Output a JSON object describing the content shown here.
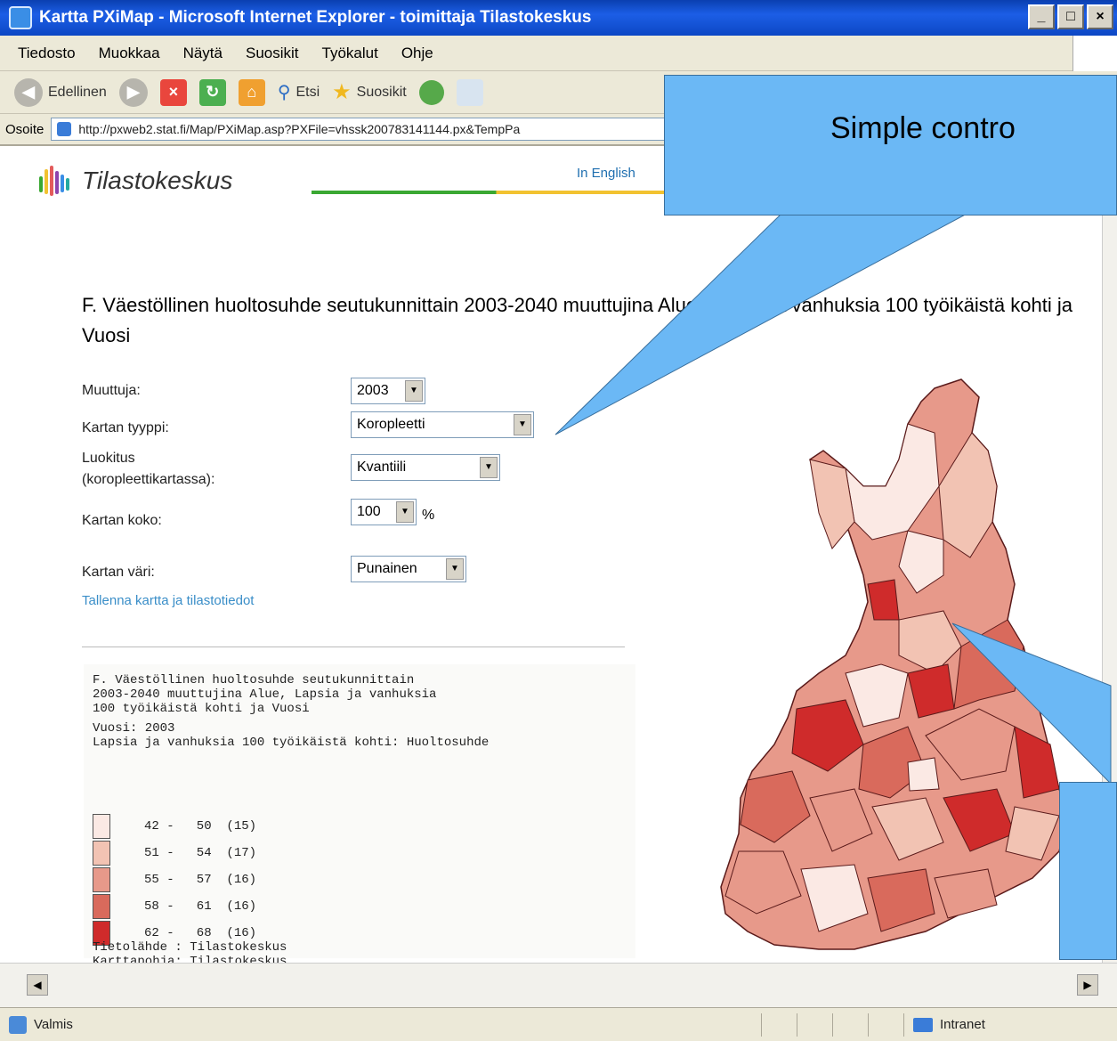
{
  "window": {
    "title": "Kartta PXiMap - Microsoft Internet Explorer - toimittaja Tilastokeskus",
    "controls": [
      "_",
      "□",
      "×"
    ]
  },
  "menu": [
    "Tiedosto",
    "Muokkaa",
    "Näytä",
    "Suosikit",
    "Työkalut",
    "Ohje"
  ],
  "toolbar": {
    "back_label": "Edellinen",
    "search_label": "Etsi",
    "favorites_label": "Suosikit"
  },
  "address": {
    "label": "Osoite",
    "url": "http://pxweb2.stat.fi/Map/PXiMap.asp?PXFile=vhssk200783141144.px&TempPa"
  },
  "site": {
    "brand": "Tilastokeskus",
    "in_english": "In English"
  },
  "page_title": "F. Väestöllinen huoltosuhde seutukunnittain 2003-2040 muuttujina Alue, Lapsia ja vanhuksia 100 työikäistä kohti ja Vuosi",
  "controls": {
    "muuttuja_label": "Muuttuja:",
    "muuttuja_value": "2003",
    "kartan_tyyppi_label": "Kartan tyyppi:",
    "kartan_tyyppi_value": "Koropleetti",
    "luokitus_label_1": "Luokitus",
    "luokitus_label_2": "(koropleettikartassa):",
    "luokitus_value": "Kvantiili",
    "kartan_koko_label": "Kartan koko:",
    "kartan_koko_value": "100",
    "kartan_koko_unit": "%",
    "kartan_vari_label": "Kartan väri:",
    "kartan_vari_value": "Punainen",
    "save_link": "Tallenna kartta ja tilastotiedot"
  },
  "info": {
    "title_lines": [
      "F. Väestöllinen huoltosuhde seutukunnittain",
      "2003-2040 muuttujina Alue, Lapsia ja vanhuksia",
      "100 työikäistä kohti ja Vuosi"
    ],
    "year_line": "Vuosi: 2003",
    "measure_line": "Lapsia ja vanhuksia 100 työikäistä kohti: Huoltosuhde",
    "legend": [
      {
        "range": "42 -   50  (15)",
        "color": "#fbe9e4"
      },
      {
        "range": "51 -   54  (17)",
        "color": "#f2c3b3"
      },
      {
        "range": "55 -   57  (16)",
        "color": "#e7998a"
      },
      {
        "range": "58 -   61  (16)",
        "color": "#d96a5c"
      },
      {
        "range": "62 -   68  (16)",
        "color": "#cf2b2b"
      }
    ],
    "source_line": "Tietolähde : Tilastokeskus",
    "basemap_line": "Karttapohja: Tilastokeskus"
  },
  "callouts": {
    "top_text": "Simple contro"
  },
  "status": {
    "left": "Valmis",
    "zone": "Intranet"
  }
}
